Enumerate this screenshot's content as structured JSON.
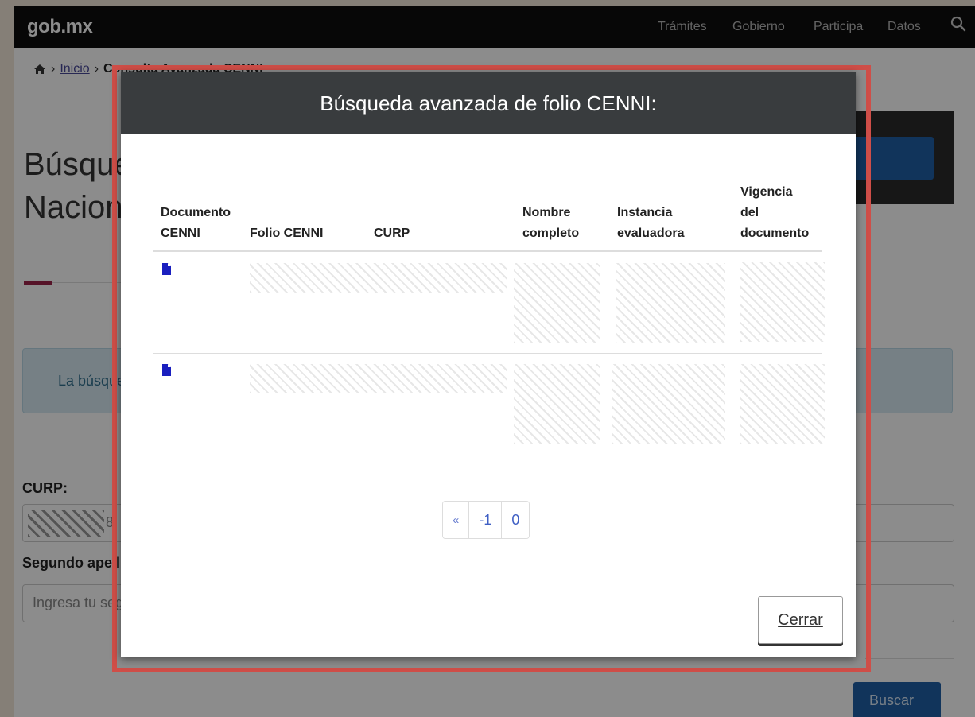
{
  "site": {
    "logo": "gob.mx",
    "nav_links": [
      "Trámites",
      "Gobierno",
      "Participa",
      "Datos"
    ],
    "search_icon": "magnifier-icon"
  },
  "breadcrumb": {
    "home_icon": "home-icon",
    "separator": "›",
    "inicio": "Inicio",
    "current": "Consulta Avanzada CENNI"
  },
  "page": {
    "title_line1": "Búsqueda",
    "title_line2": "Nacional",
    "alert_text": "La búsqueda",
    "curp_label": "CURP:",
    "curp_value": "8",
    "segundo_apellido_label": "Segundo apellido",
    "segundo_apellido_placeholder": "Ingresa tu segundo apellido",
    "search_button": "Buscar"
  },
  "modal": {
    "title": "Búsqueda avanzada de folio CENNI:",
    "columns": [
      {
        "line1": "Documento",
        "line2": "CENNI",
        "line3": ""
      },
      {
        "line1": "Folio CENNI",
        "line2": "",
        "line3": ""
      },
      {
        "line1": "CURP",
        "line2": "",
        "line3": ""
      },
      {
        "line1": "Nombre",
        "line2": "completo",
        "line3": ""
      },
      {
        "line1": "Instancia",
        "line2": "evaluadora",
        "line3": ""
      },
      {
        "line1": "Vigencia",
        "line2": "del",
        "line3": "documento"
      }
    ],
    "rows": [
      {
        "document_icon": "file-icon",
        "folio": "",
        "curp": "",
        "nombre": "",
        "instancia": "",
        "vigencia": ""
      },
      {
        "document_icon": "file-icon",
        "folio": "",
        "curp": "",
        "nombre": "",
        "instancia": "",
        "vigencia": ""
      }
    ],
    "pagination": {
      "prev": "«",
      "pages": [
        "-1",
        "0"
      ]
    },
    "close_button": "Cerrar"
  },
  "colors": {
    "navbar": "#0d0d0d",
    "modal_header": "#393c3e",
    "highlight_border": "#cf4e48",
    "accent_red": "#9d2449",
    "primary_blue": "#1f5fa6",
    "doc_icon": "#1a1fbf"
  }
}
